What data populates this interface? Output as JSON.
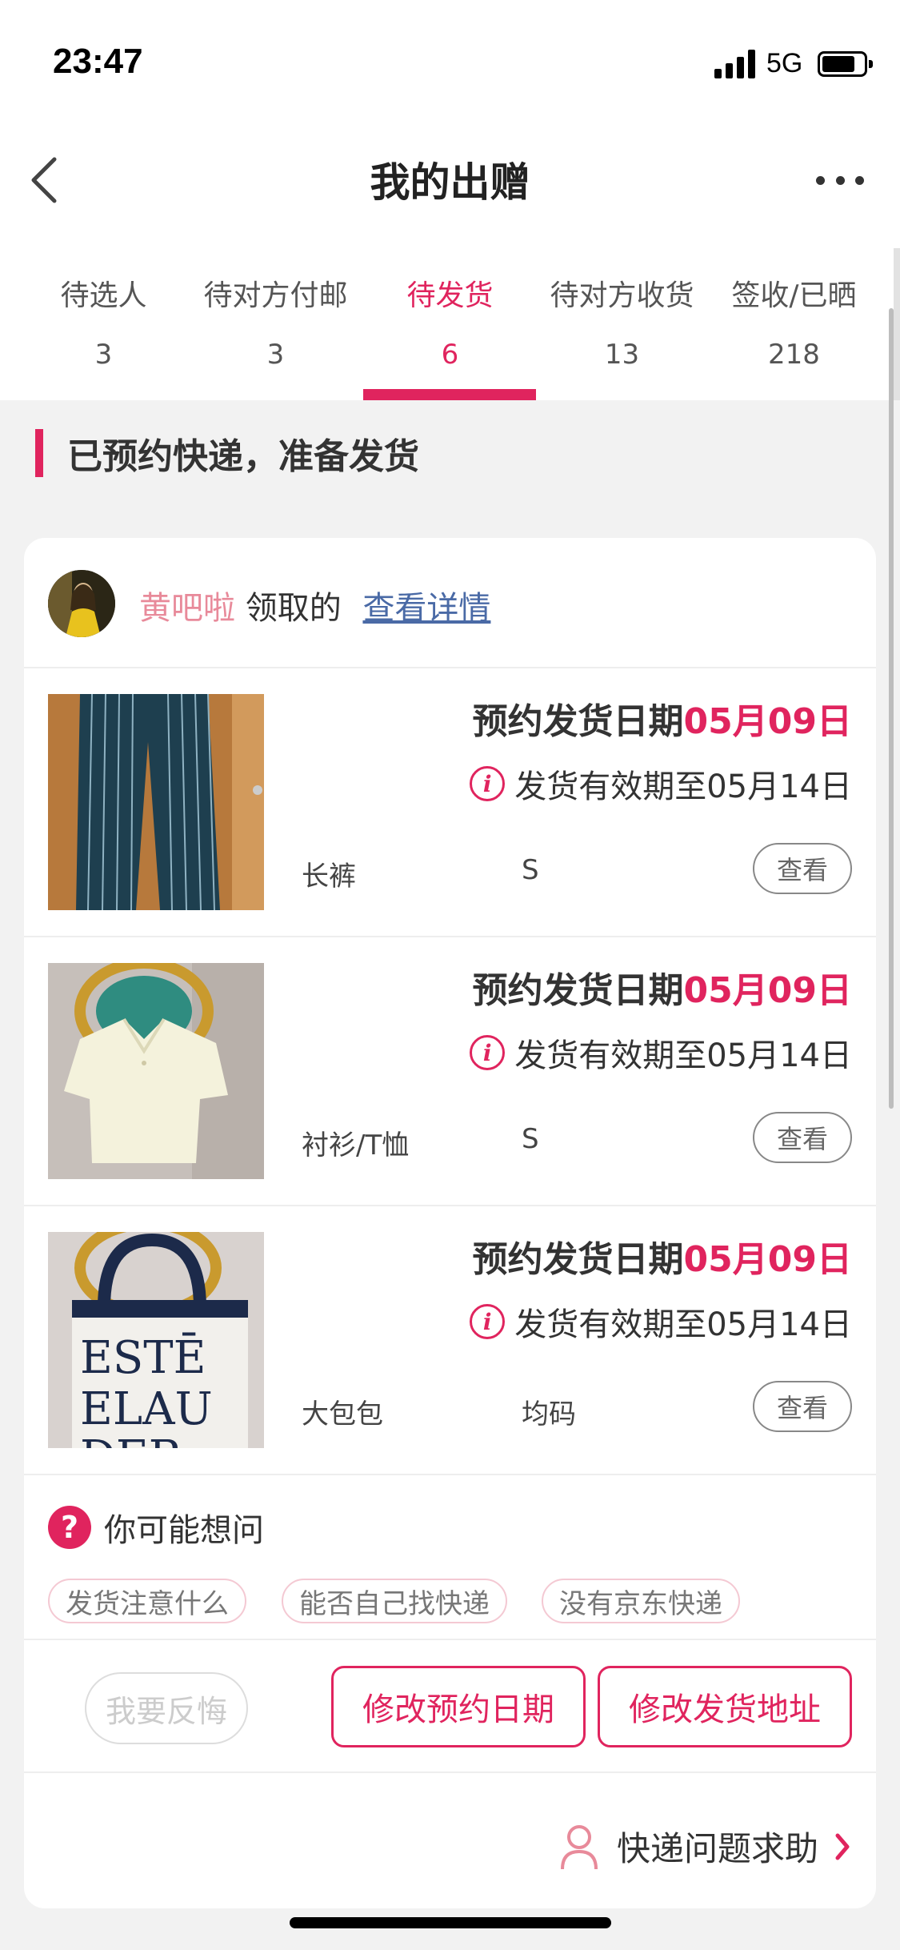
{
  "status_bar": {
    "time": "23:47",
    "network": "5G"
  },
  "nav": {
    "title": "我的出赠"
  },
  "tabs": [
    {
      "label": "待选人",
      "count": "3",
      "active": false
    },
    {
      "label": "待对方付邮",
      "count": "3",
      "active": false
    },
    {
      "label": "待发货",
      "count": "6",
      "active": true
    },
    {
      "label": "待对方收货",
      "count": "13",
      "active": false
    },
    {
      "label": "签收/已晒",
      "count": "218",
      "active": false
    }
  ],
  "section": {
    "heading": "已预约快递，准备发货"
  },
  "order": {
    "receiver_name": "黄吧啦",
    "receiver_suffix": "领取的",
    "detail_link": "查看详情",
    "items": [
      {
        "ship_label": "预约发货日期",
        "ship_date": "05月09日",
        "valid_text": "发货有效期至05月14日",
        "type": "长裤",
        "size": "S",
        "view_label": "查看"
      },
      {
        "ship_label": "预约发货日期",
        "ship_date": "05月09日",
        "valid_text": "发货有效期至05月14日",
        "type": "衬衫/T恤",
        "size": "S",
        "view_label": "查看"
      },
      {
        "ship_label": "预约发货日期",
        "ship_date": "05月09日",
        "valid_text": "发货有效期至05月14日",
        "type": "大包包",
        "size": "均码",
        "view_label": "查看",
        "image_text": [
          "ESTĒ",
          "ELAU",
          "DER"
        ]
      }
    ]
  },
  "faq": {
    "title": "你可能想问",
    "chips": [
      "发货注意什么",
      "能否自己找快递",
      "没有京东快递"
    ]
  },
  "actions": {
    "regret": "我要反悔",
    "change_date": "修改预约日期",
    "change_address": "修改发货地址"
  },
  "help": {
    "label": "快递问题求助"
  },
  "colors": {
    "accent": "#e0245e",
    "link": "#4a6aa6",
    "name": "#e88a9a"
  }
}
